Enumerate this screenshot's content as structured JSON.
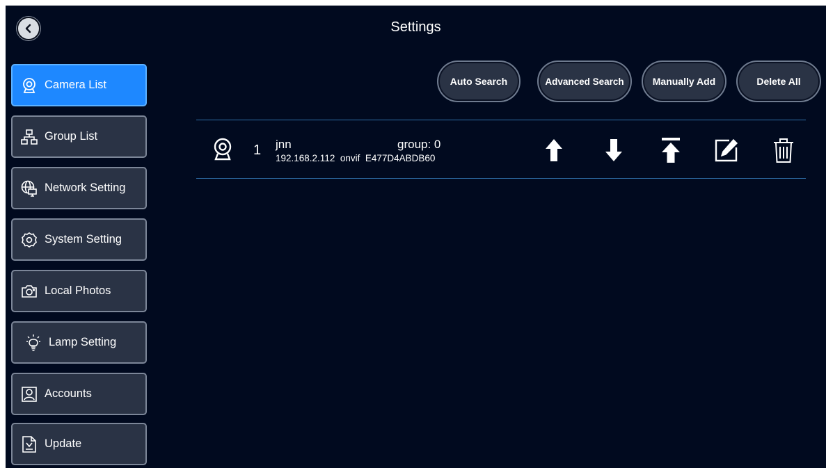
{
  "header": {
    "title": "Settings",
    "back_icon": "chevron-left-icon"
  },
  "sidebar": {
    "items": [
      {
        "label": "Camera List",
        "icon": "webcam-icon",
        "active": true
      },
      {
        "label": "Group List",
        "icon": "hierarchy-icon",
        "active": false
      },
      {
        "label": "Network Setting",
        "icon": "globe-monitor-icon",
        "active": false
      },
      {
        "label": "System Setting",
        "icon": "gear-icon",
        "active": false
      },
      {
        "label": "Local Photos",
        "icon": "camera-icon",
        "active": false
      },
      {
        "label": "Lamp Setting",
        "icon": "lightbulb-icon",
        "active": false
      },
      {
        "label": "Accounts",
        "icon": "user-icon",
        "active": false
      },
      {
        "label": "Update",
        "icon": "download-document-icon",
        "active": false
      }
    ]
  },
  "toolbar": {
    "auto_search": "Auto Search",
    "advanced_search": "Advanced Search",
    "manually_add": "Manually Add",
    "delete_all": "Delete All"
  },
  "cameras": [
    {
      "index": "1",
      "name": "jnn",
      "group": "group: 0",
      "details": "192.168.2.112  onvif  E477D4ABDB60",
      "actions": [
        "arrow-up-icon",
        "arrow-down-icon",
        "move-to-top-icon",
        "edit-icon",
        "trash-icon"
      ]
    }
  ],
  "colors": {
    "background": "#010a1f",
    "active_item": "#1e88ff",
    "item_background": "#2a3345",
    "divider": "#2f6ea8"
  }
}
